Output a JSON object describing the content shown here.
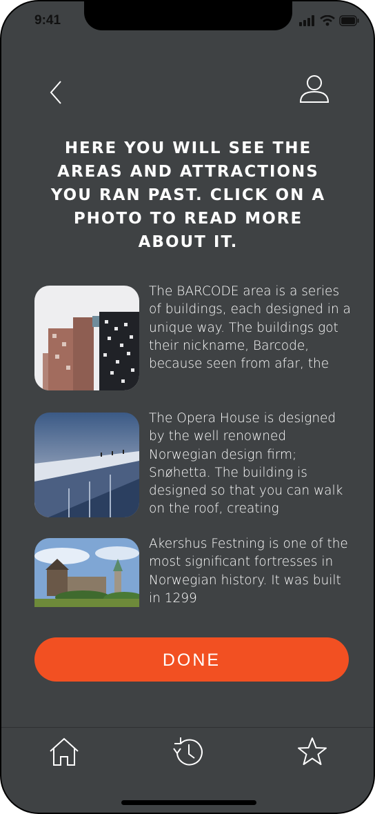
{
  "status": {
    "time": "9:41"
  },
  "header": {
    "back_icon": "chevron-left-icon",
    "profile_icon": "user-icon",
    "headline": "HERE YOU WILL SEE THE AREAS AND ATTRACTIONS YOU RAN PAST. CLICK ON A PHOTO TO READ MORE ABOUT IT."
  },
  "attractions": [
    {
      "text": "The BARCODE area is a series of buildings, each designed in a unique way. The buildings got their nickname, Barcode, because seen from afar, the"
    },
    {
      "text": "The Opera House is designed by the well renowned Norwegian design firm; Snøhetta. The building is designed so that you can walk on the roof, creating"
    },
    {
      "text": "Akershus Festning is one of the most significant fortresses in Norwegian history. It was built in 1299"
    }
  ],
  "done_button": {
    "label": "DONE",
    "color": "#f25022"
  },
  "tabbar": {
    "items": [
      {
        "icon": "home-icon"
      },
      {
        "icon": "history-icon"
      },
      {
        "icon": "star-icon"
      }
    ]
  },
  "colors": {
    "background": "#3f4244",
    "accent": "#f25022",
    "text": "#ffffff"
  }
}
